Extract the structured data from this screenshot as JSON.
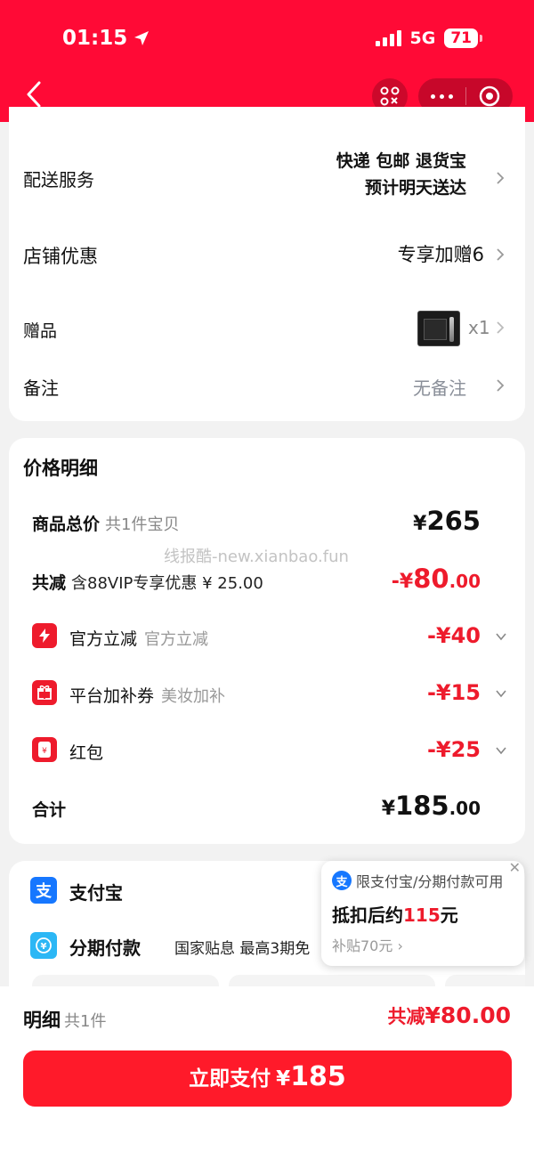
{
  "status_bar": {
    "time": "01:15",
    "network": "5G",
    "battery": "71"
  },
  "delivery": {
    "label": "配送服务",
    "line1": "快递 包邮 退货宝",
    "line2": "预计明天送达"
  },
  "shop_discount": {
    "label": "店铺优惠",
    "value": "专享加赠6"
  },
  "gift": {
    "label": "赠品",
    "quantity": "x1"
  },
  "remark": {
    "label": "备注",
    "value": "无备注"
  },
  "price_detail": {
    "title": "价格明细",
    "watermark": "线报酷-new.xianbao.fun",
    "total": {
      "label": "商品总价",
      "sub": "共1件宝贝",
      "currency": "¥",
      "amount": "265"
    },
    "reduction": {
      "label": "共减",
      "sub": "含88VIP专享优惠 ¥ 25.00",
      "prefix": "-¥",
      "amount": "80",
      "decimal": ".00"
    },
    "items": [
      {
        "label": "官方立减",
        "sub": "官方立减",
        "amount": "-¥40",
        "icon": "lightning-icon"
      },
      {
        "label": "平台加补券",
        "sub": "美妆加补",
        "amount": "-¥15",
        "icon": "gift-icon"
      },
      {
        "label": "红包",
        "sub": "",
        "amount": "-¥25",
        "icon": "red-packet-icon"
      }
    ],
    "subtotal": {
      "label": "合计",
      "currency": "¥",
      "amount": "185",
      "decimal": ".00"
    }
  },
  "payment": {
    "alipay": {
      "label": "支付宝",
      "icon_char": "支"
    },
    "installment": {
      "label": "分期付款",
      "note": "国家贴息 最高3期免"
    }
  },
  "tooltip": {
    "line1": "限支付宝/分期付款可用",
    "line2_prefix": "抵扣后约",
    "line2_amount": "115",
    "line2_suffix": "元",
    "line3": "补贴70元"
  },
  "bottom": {
    "detail_label": "明细",
    "detail_sub": "共1件",
    "discount_label": "共减",
    "discount_amount": "¥80.00",
    "pay_button_text": "立即支付",
    "pay_button_currency": "¥",
    "pay_button_amount": "185"
  },
  "colors": {
    "brand_red": "#ff0a36",
    "price_red": "#ee1b2c",
    "alipay_blue": "#1677ff"
  }
}
